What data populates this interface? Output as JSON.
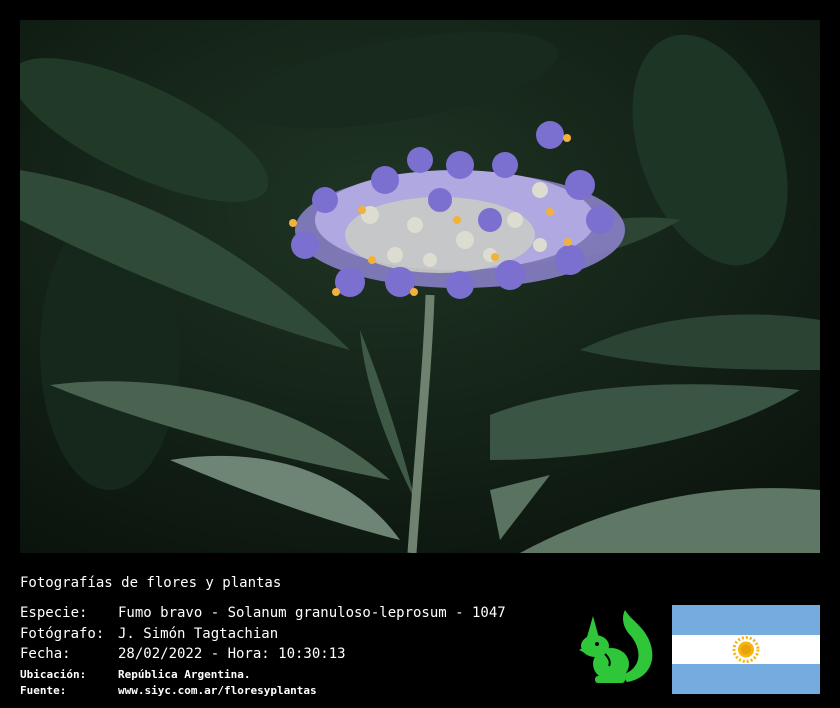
{
  "header": {
    "title": "Fotografías de flores y plantas"
  },
  "info": {
    "especie_label": "Especie:",
    "especie_value": "Fumo bravo - Solanum granuloso-leprosum - 1047",
    "fotografo_label": "Fotógrafo:",
    "fotografo_value": "J. Simón Tagtachian",
    "fecha_label": "Fecha:",
    "fecha_value": "28/02/2022 - Hora: 10:30:13",
    "ubicacion_label": "Ubicación:",
    "ubicacion_value": "República Argentina.",
    "fuente_label": "Fuente:",
    "fuente_value": "www.siyc.com.ar/floresyplantas"
  },
  "colors": {
    "background": "#000000",
    "text": "#ffffff",
    "logo_green": "#2fc63a",
    "flag_blue": "#74acdf",
    "sun_gold": "#f6b40e"
  },
  "icons": {
    "logo": "squirrel-logo-icon",
    "flag": "argentina-flag-icon"
  }
}
